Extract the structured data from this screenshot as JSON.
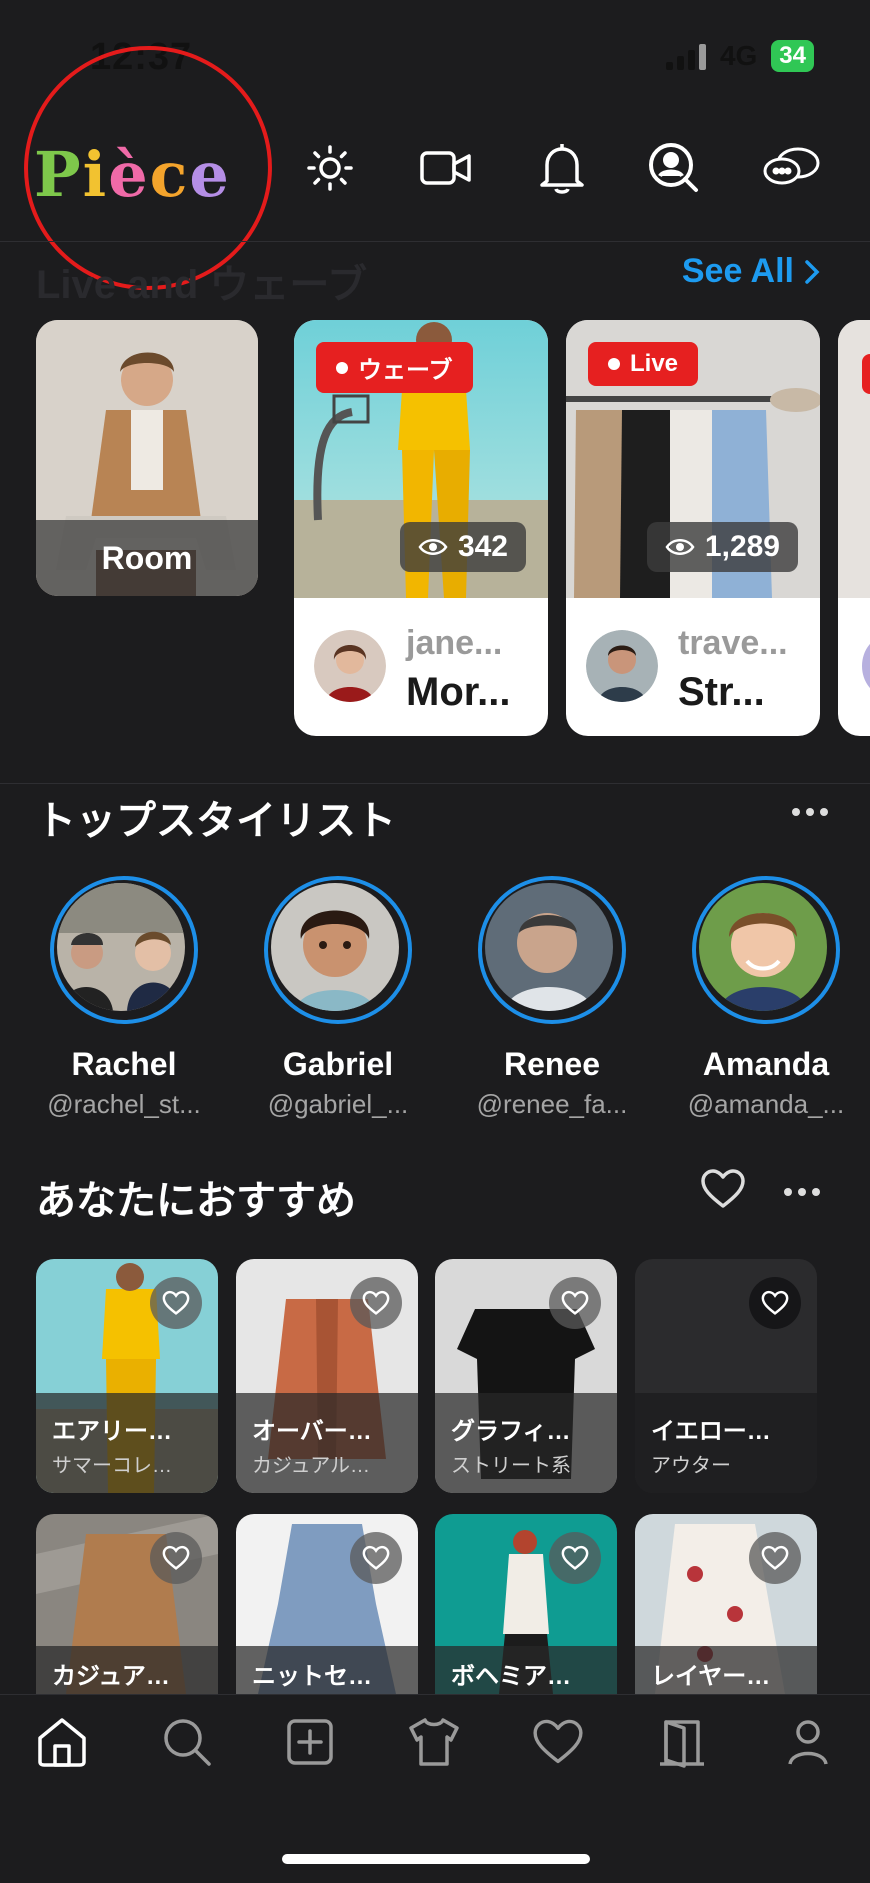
{
  "status": {
    "time": "12:37",
    "network": "4G",
    "battery": "34"
  },
  "header": {
    "logo_letters": [
      {
        "ch": "P",
        "color": "#7ec84b"
      },
      {
        "ch": "i",
        "color": "#f2c230"
      },
      {
        "ch": "è",
        "color": "#f06aa8"
      },
      {
        "ch": "c",
        "color": "#f4a42c"
      },
      {
        "ch": "e",
        "color": "#b58ee6"
      }
    ],
    "icons": [
      "sun-icon",
      "video-camera-icon",
      "bell-icon",
      "profile-search-icon",
      "chat-bubbles-icon"
    ]
  },
  "live": {
    "title": "Live and ウェーブ",
    "see_all": "See All",
    "room_label": "Room",
    "cards": [
      {
        "badge": "ウェーブ",
        "views": "342",
        "user": "jane...",
        "title": "Mor..."
      },
      {
        "badge": "Live",
        "views": "1,289",
        "user": "trave...",
        "title": "Str..."
      }
    ]
  },
  "stylists": {
    "title": "トップスタイリスト",
    "items": [
      {
        "name": "Rachel",
        "handle": "@rachel_st..."
      },
      {
        "name": "Gabriel",
        "handle": "@gabriel_..."
      },
      {
        "name": "Renee",
        "handle": "@renee_fa..."
      },
      {
        "name": "Amanda",
        "handle": "@amanda_..."
      }
    ]
  },
  "recommend": {
    "title": "あなたにおすすめ",
    "row1": [
      {
        "title": "エアリー…",
        "sub": "サマーコレ…"
      },
      {
        "title": "オーバー…",
        "sub": "カジュアル…"
      },
      {
        "title": "グラフィ…",
        "sub": "ストリート系"
      },
      {
        "title": "イエロー…",
        "sub": "アウター"
      }
    ],
    "row2": [
      {
        "title": "カジュア…"
      },
      {
        "title": "ニットセ…"
      },
      {
        "title": "ボヘミア…"
      },
      {
        "title": "レイヤー…"
      }
    ]
  },
  "nav": [
    "home-icon",
    "search-icon",
    "add-icon",
    "shirt-icon",
    "heart-icon",
    "door-icon",
    "profile-icon"
  ],
  "colors": {
    "accent": "#1d9bf0",
    "live_red": "#e62020",
    "background": "#1c1c1e",
    "annotation": "#e41b1b"
  }
}
